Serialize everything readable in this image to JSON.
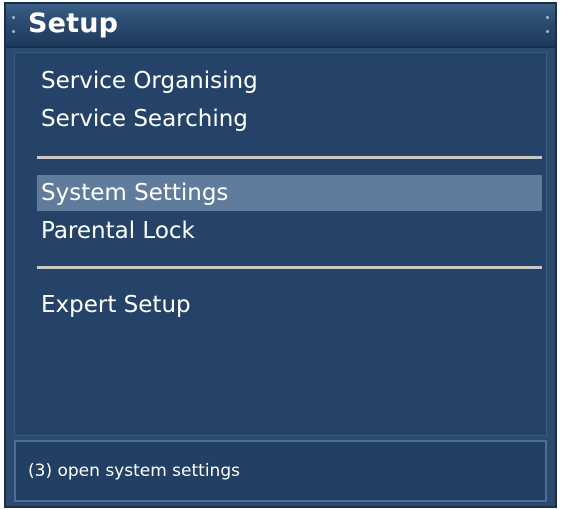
{
  "window": {
    "title": "Setup"
  },
  "menu": {
    "items": [
      {
        "label": "Service Organising",
        "selected": false
      },
      {
        "label": "Service Searching",
        "selected": false
      },
      {
        "label": "System Settings",
        "selected": true
      },
      {
        "label": "Parental Lock",
        "selected": false
      },
      {
        "label": "Expert Setup",
        "selected": false
      }
    ]
  },
  "status": {
    "text": "(3) open system settings"
  },
  "colors": {
    "background": "#2b4a6e",
    "selection": "#5f7c9c",
    "divider": "#c8c9c4",
    "text": "#ffffff"
  }
}
